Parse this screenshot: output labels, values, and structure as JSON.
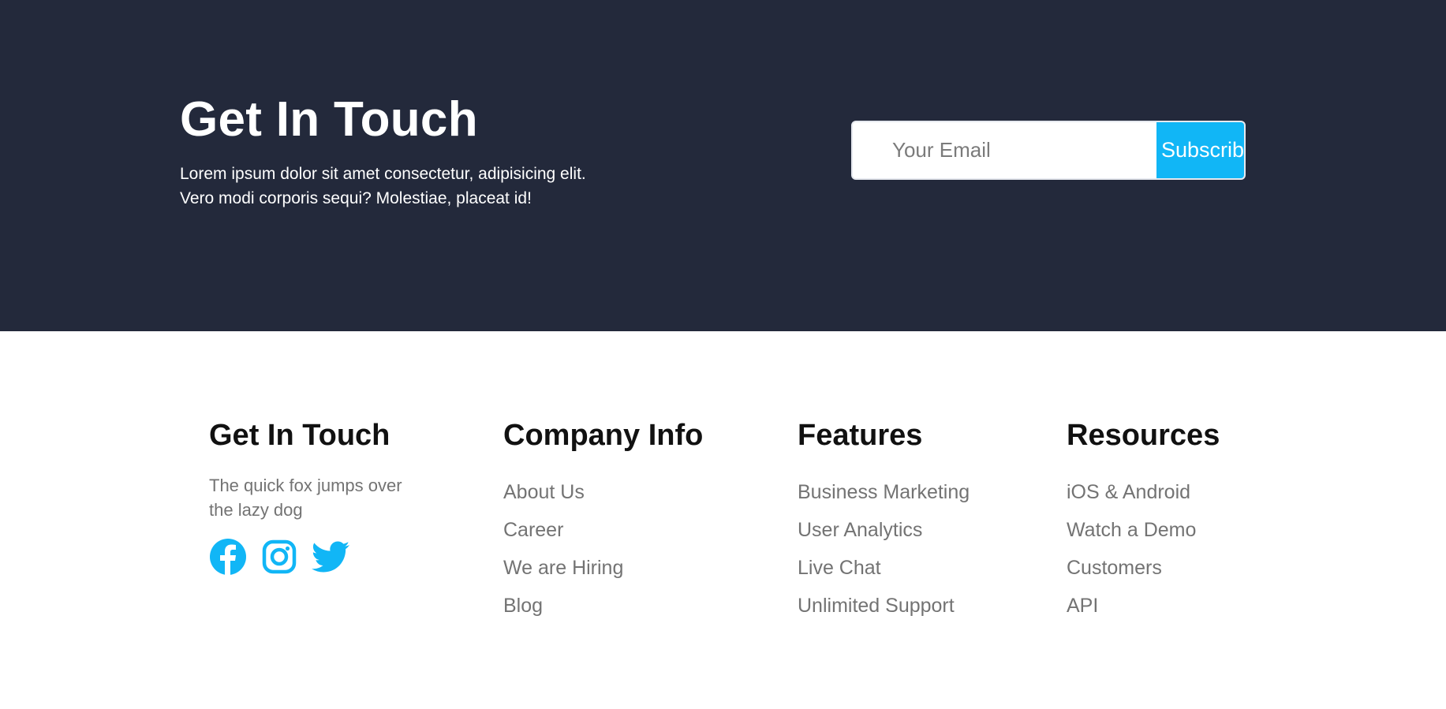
{
  "hero": {
    "title": "Get In Touch",
    "text_line1": "Lorem ipsum dolor sit amet consectetur, adipisicing elit.",
    "text_line2": "Vero modi corporis sequi? Molestiae, placeat id!",
    "email_placeholder": "Your Email",
    "email_value": "",
    "subscribe_label": "Subscribe"
  },
  "footer": {
    "contact": {
      "title": "Get In Touch",
      "text_line1": "The quick fox jumps over",
      "text_line2": "the lazy dog",
      "social_icons": [
        "facebook-icon",
        "instagram-icon",
        "twitter-icon"
      ]
    },
    "company": {
      "title": "Company Info",
      "links": [
        "About Us",
        "Career",
        "We are Hiring",
        "Blog"
      ]
    },
    "features": {
      "title": "Features",
      "links": [
        "Business Marketing",
        "User Analytics",
        "Live Chat",
        "Unlimited Support"
      ]
    },
    "resources": {
      "title": "Resources",
      "links": [
        "iOS & Android",
        "Watch a Demo",
        "Customers",
        "API"
      ]
    }
  },
  "colors": {
    "hero_background": "#23293b",
    "accent": "#11b6f6",
    "heading": "#111111",
    "muted_text": "#737373"
  }
}
